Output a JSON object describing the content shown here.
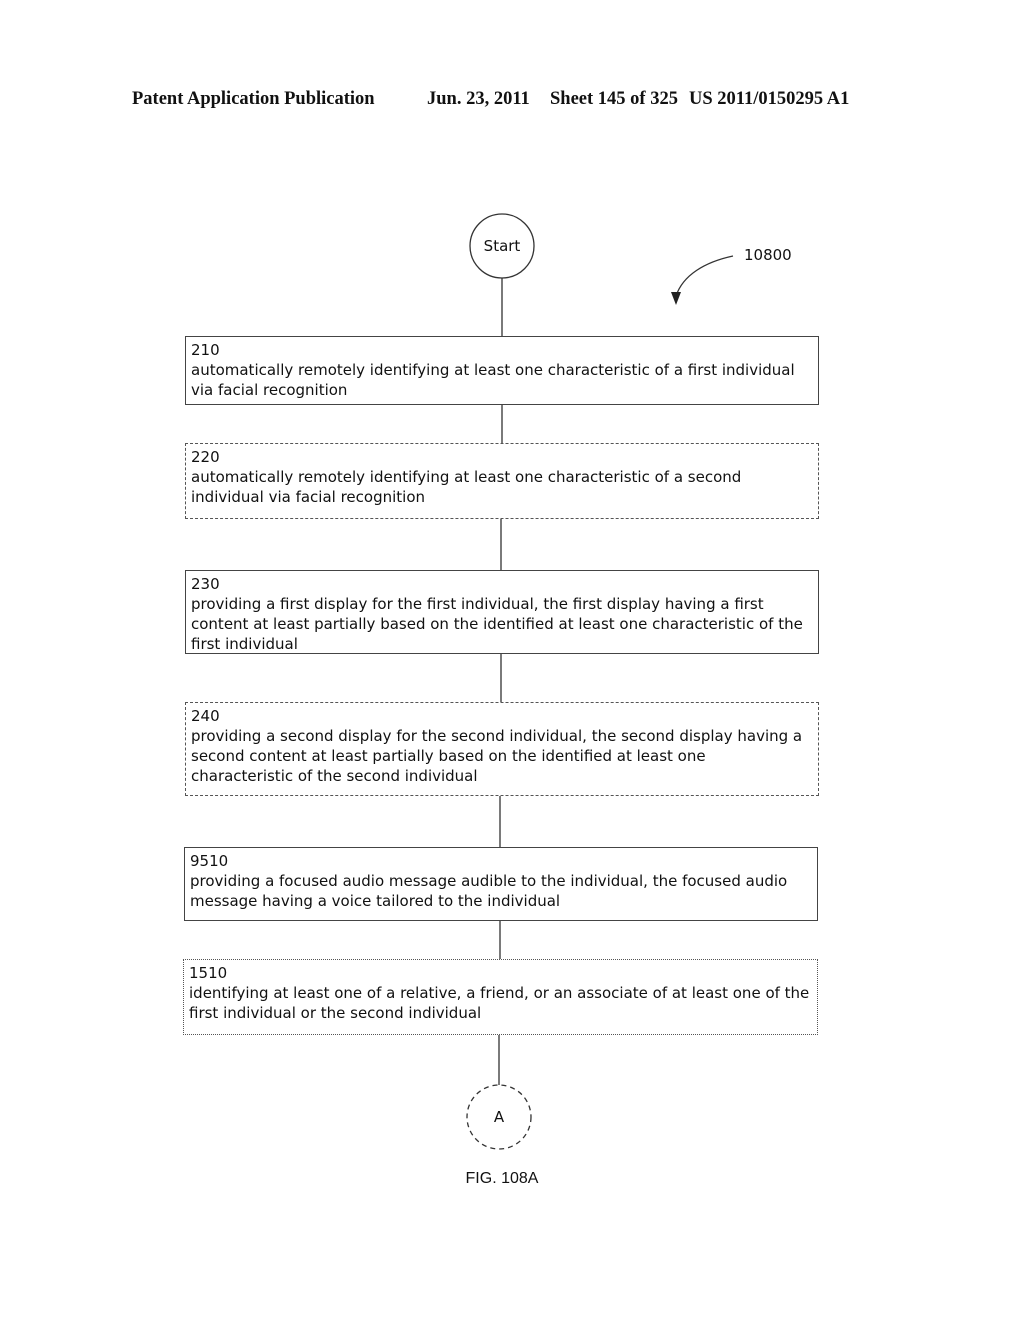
{
  "header": {
    "publication": "Patent Application Publication",
    "date": "Jun. 23, 2011",
    "sheet": "Sheet 145 of 325",
    "number": "US 2011/0150295 A1"
  },
  "diagram": {
    "reference": "10800",
    "start_label": "Start",
    "connector_label": "A",
    "figure_caption": "FIG. 108A",
    "steps": [
      {
        "id": "210",
        "style": "solid",
        "text": "automatically remotely identifying at least one characteristic of a first individual via facial recognition"
      },
      {
        "id": "220",
        "style": "dashed",
        "text": "automatically remotely identifying at least one characteristic of a second individual via facial recognition"
      },
      {
        "id": "230",
        "style": "solid",
        "text": "providing a first display for the first individual, the first display having a first content at least partially based on the identified at least one characteristic of the first individual"
      },
      {
        "id": "240",
        "style": "dashed",
        "text": "providing a second display for the second individual, the second display having a second content at least partially based on the identified at least one characteristic of the second individual"
      },
      {
        "id": "9510",
        "style": "solid",
        "text": "providing a focused audio message audible to the individual, the focused audio message having a voice tailored to the individual"
      },
      {
        "id": "1510",
        "style": "dotted",
        "text": "identifying at least one of a relative, a friend, or an associate of at least one of the first individual or the second individual"
      }
    ]
  }
}
